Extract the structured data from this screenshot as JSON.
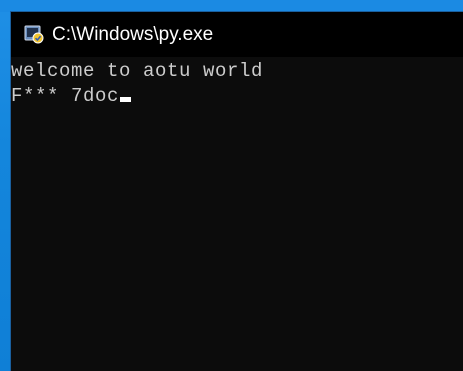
{
  "window": {
    "title": "C:\\Windows\\py.exe",
    "icon": "python-launcher-icon"
  },
  "console": {
    "lines": [
      "welcome to aotu world",
      "F*** 7doc"
    ]
  },
  "colors": {
    "desktop": "#1486dc",
    "title_bar": "#000000",
    "console_bg": "#0c0c0c",
    "console_text": "#cccccc",
    "cursor": "#ffffff"
  }
}
